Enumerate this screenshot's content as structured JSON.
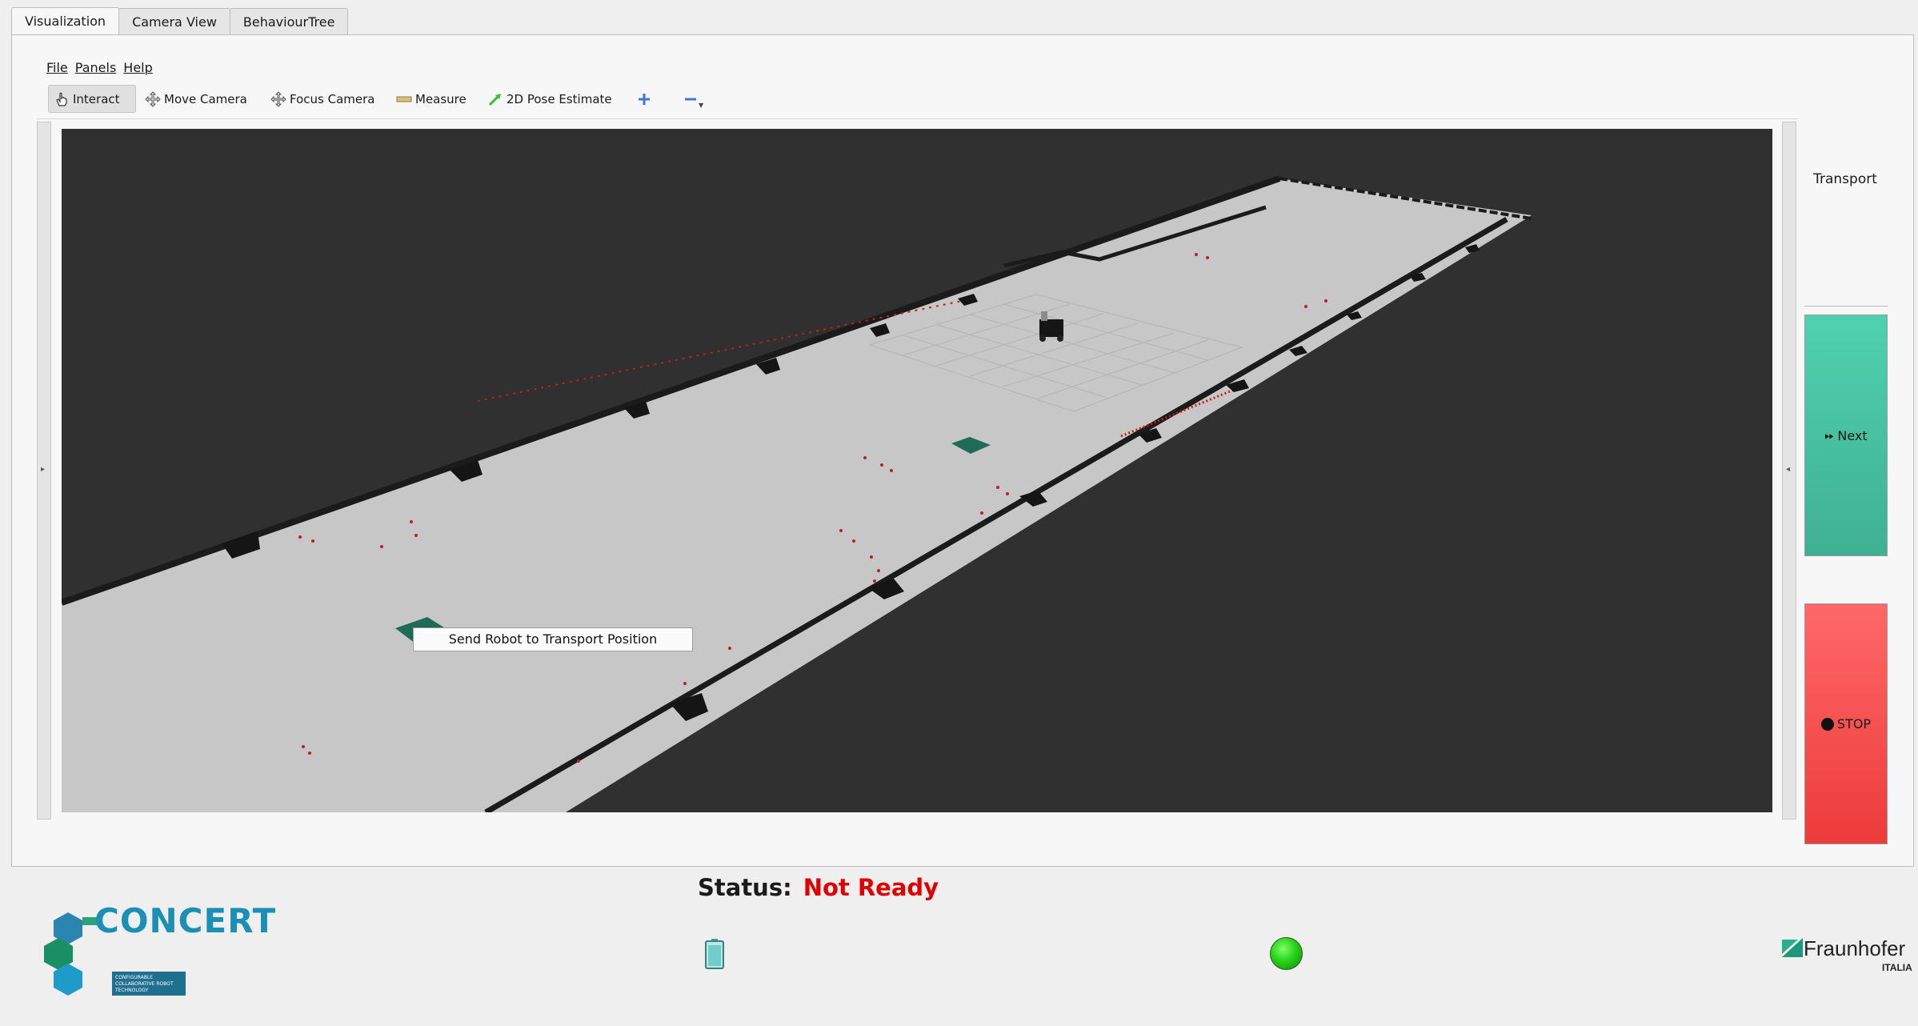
{
  "tabs": [
    {
      "label": "Visualization",
      "active": true
    },
    {
      "label": "Camera View",
      "active": false
    },
    {
      "label": "BehaviourTree",
      "active": false
    }
  ],
  "menu": [
    "File",
    "Panels",
    "Help"
  ],
  "toolbar": {
    "interact": "Interact",
    "move_camera": "Move Camera",
    "focus_camera": "Focus Camera",
    "measure": "Measure",
    "pose_estimate": "2D Pose Estimate",
    "add_icon": "plus-icon",
    "remove_icon": "minus-icon"
  },
  "context_menu": {
    "item": "Send Robot to Transport Position"
  },
  "side_panel": {
    "title": "Transport",
    "next_label": "Next",
    "next_icon": "fast-forward-icon",
    "stop_label": "STOP",
    "stop_icon": "stop-icon",
    "next_color": "#46c3a2",
    "stop_color": "#f25050"
  },
  "status": {
    "label": "Status:",
    "value": "Not Ready",
    "value_color": "#e00000"
  },
  "indicators": {
    "battery_icon": "battery-icon",
    "led_color": "#28d21a"
  },
  "logos": {
    "left": "CONCERT",
    "left_tagline": "CONFIGURABLE COLLABORATIVE ROBOT TECHNOLOGY",
    "right": "Fraunhofer",
    "right_sub": "ITALIA"
  }
}
